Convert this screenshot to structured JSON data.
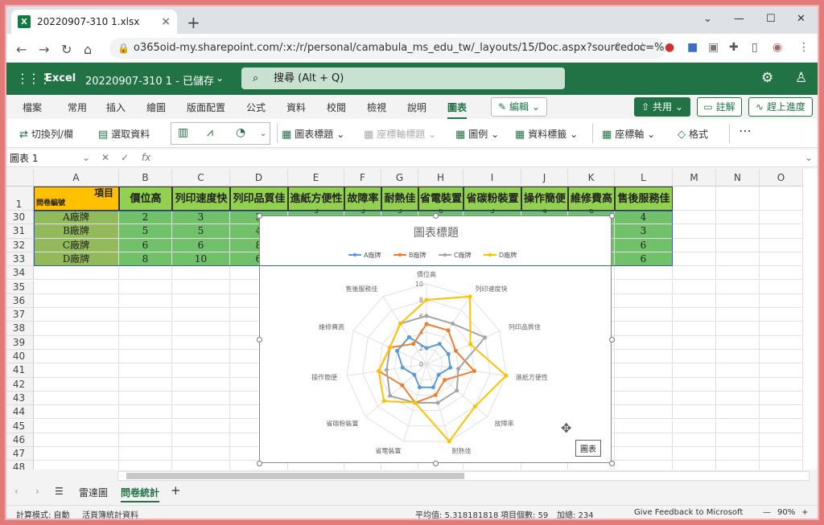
{
  "browser": {
    "tab_title": "20220907-310 1.xlsx",
    "url": "o365oid-my.sharepoint.com/:x:/r/personal/camabula_ms_edu_tw/_layouts/15/Doc.aspx?sourcedoc=%7..."
  },
  "excel": {
    "app_name": "Excel",
    "doc_name": "20220907-310 1 - 已儲存",
    "search_placeholder": "搜尋 (Alt + Q)"
  },
  "menu": {
    "items": [
      "檔案",
      "常用",
      "插入",
      "繪圖",
      "版面配置",
      "公式",
      "資料",
      "校閱",
      "檢視",
      "說明",
      "圖表"
    ],
    "edit": "編輯",
    "share": "共用",
    "comments": "註解",
    "catchup": "趕上進度"
  },
  "ribbon": {
    "switch_row_col": "切換列/欄",
    "select_data": "選取資料",
    "chart_title": "圖表標題",
    "axis_title": "座標軸標題",
    "legend": "圖例",
    "data_labels": "資料標籤",
    "axes": "座標軸",
    "format": "格式",
    "more": "⋯"
  },
  "formula_bar": {
    "name_box": "圖表 1",
    "fx": "fx"
  },
  "sheet": {
    "columns": [
      "A",
      "B",
      "C",
      "D",
      "E",
      "F",
      "G",
      "H",
      "I",
      "J",
      "K",
      "L",
      "M",
      "N",
      "O"
    ],
    "rows": [
      "1",
      "30",
      "31",
      "32",
      "33",
      "34",
      "35",
      "36",
      "37",
      "38",
      "39",
      "40",
      "41",
      "42",
      "43",
      "44",
      "45",
      "46",
      "47",
      "48"
    ],
    "a1_top": "項目",
    "a1_bottom": "問卷編號",
    "headers": [
      "價位高",
      "列印速度快",
      "列印品質佳",
      "進紙方便性",
      "故障率",
      "耐熱佳",
      "省電裝置",
      "省碳粉裝置",
      "操作簡便",
      "維修費高",
      "售後服務佳"
    ],
    "brands": [
      "A廠牌",
      "B廠牌",
      "C廠牌",
      "D廠牌"
    ],
    "values": [
      [
        "2",
        "3",
        "3",
        "",
        "",
        "",
        "",
        "",
        "",
        "",
        "4"
      ],
      [
        "5",
        "5",
        "4",
        "",
        "",
        "",
        "",
        "",
        "",
        "",
        "3"
      ],
      [
        "6",
        "6",
        "8",
        "",
        "",
        "",
        "",
        "",
        "",
        "",
        "6"
      ],
      [
        "8",
        "10",
        "6",
        "",
        "",
        "",
        "",
        "",
        "",
        "",
        "6"
      ]
    ],
    "peek_row30": [
      "3",
      "3",
      "3",
      "6",
      "3",
      "4",
      "6"
    ]
  },
  "chart_data": {
    "type": "radar",
    "title": "圖表標題",
    "axes": [
      "價位高",
      "列印速度快",
      "列印品質佳",
      "進紙方便性",
      "故障率",
      "耐熱佳",
      "省電裝置",
      "省碳粉裝置",
      "操作簡便",
      "維修費高",
      "售後服務佳"
    ],
    "ticks": [
      "0",
      "2",
      "4",
      "6",
      "8",
      "10"
    ],
    "rmax": 10,
    "series": [
      {
        "name": "A廠牌",
        "color": "#5b9bd5",
        "values": [
          2,
          3,
          3,
          3,
          2,
          3,
          3,
          2,
          3,
          4,
          4
        ]
      },
      {
        "name": "B廠牌",
        "color": "#ed7d31",
        "values": [
          5,
          5,
          4,
          6,
          3,
          4,
          5,
          4,
          6,
          5,
          3
        ]
      },
      {
        "name": "C廠牌",
        "color": "#a5a5a5",
        "values": [
          6,
          6,
          8,
          4,
          5,
          5,
          5,
          6,
          5,
          5,
          6
        ]
      },
      {
        "name": "D廠牌",
        "color": "#ffc000",
        "values": [
          8,
          10,
          6,
          10,
          8,
          10,
          5,
          7,
          6,
          5,
          6
        ]
      }
    ]
  },
  "chart_tooltip": "圖表",
  "sheet_tabs": [
    "雷達圖",
    "問卷統計"
  ],
  "status": {
    "calc_mode": "計算模式: 自動",
    "workbook_stats": "活頁簿統計資料",
    "average": "平均值: 5.318181818",
    "count": "項目個數: 59",
    "sum": "加總: 234",
    "feedback": "Give Feedback to Microsoft",
    "zoom": "90%"
  }
}
